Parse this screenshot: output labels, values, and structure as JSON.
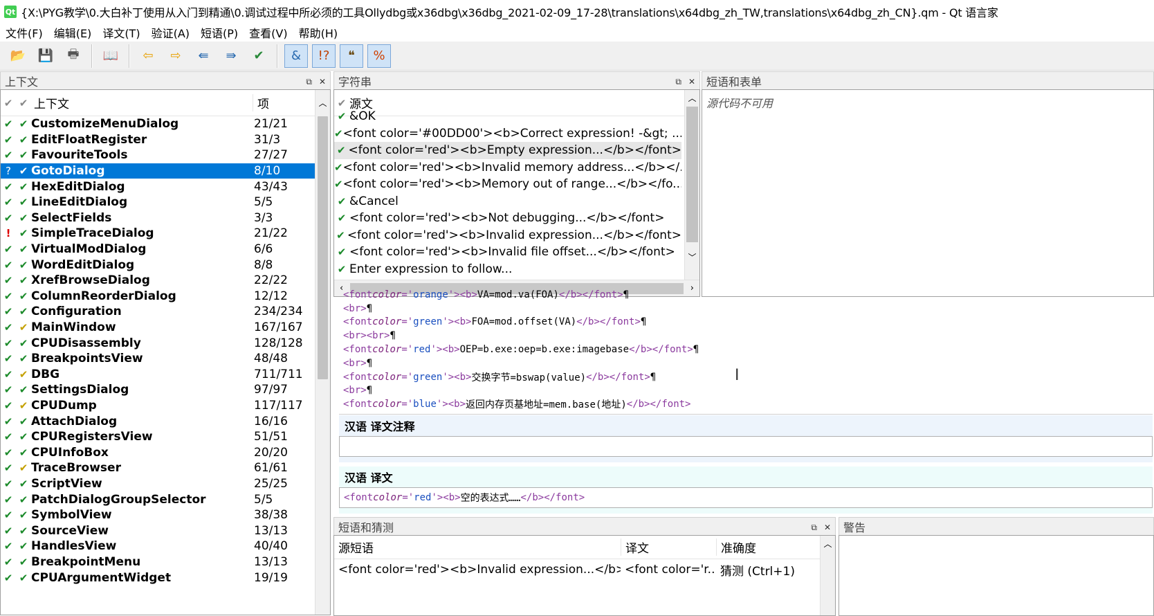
{
  "window": {
    "title": "{X:\\PYG教学\\0.大白补丁使用从入门到精通\\0.调试过程中所必须的工具Ollydbg或x36dbg\\x36dbg_2021-02-09_17-28\\translations\\x64dbg_zh_TW,translations\\x64dbg_zh_CN}.qm - Qt 语言家",
    "icon_label": "Qt"
  },
  "menu": [
    "文件(F)",
    "编辑(E)",
    "译文(T)",
    "验证(A)",
    "短语(P)",
    "查看(V)",
    "帮助(H)"
  ],
  "toolbar": {
    "buttons": [
      {
        "icon": "open-folder-icon",
        "glyph": "📂",
        "active": false
      },
      {
        "icon": "save-icon",
        "glyph": "💾",
        "active": false
      },
      {
        "icon": "print-icon",
        "glyph": "🖶",
        "active": false
      },
      {
        "icon": "phrasebook-icon",
        "glyph": "📖",
        "active": false
      },
      {
        "icon": "prev-arrow-icon",
        "glyph": "⇦",
        "active": false
      },
      {
        "icon": "next-arrow-icon",
        "glyph": "⇨",
        "active": false
      },
      {
        "icon": "prev-unfinished-icon",
        "glyph": "⇚",
        "active": false
      },
      {
        "icon": "next-unfinished-icon",
        "glyph": "⇛",
        "active": false
      },
      {
        "icon": "done-next-icon",
        "glyph": "✔",
        "active": false
      },
      {
        "icon": "accelerator-check-icon",
        "glyph": "&",
        "active": true
      },
      {
        "icon": "punctuation-check-icon",
        "glyph": "!?",
        "active": true
      },
      {
        "icon": "phrase-match-icon",
        "glyph": "❝",
        "active": true
      },
      {
        "icon": "placeholder-check-icon",
        "glyph": "%",
        "active": true
      }
    ]
  },
  "context_panel": {
    "title": "上下文",
    "col_context": "上下文",
    "col_items": "项",
    "rows": [
      {
        "status": "ok",
        "name": "CustomizeMenuDialog",
        "count": "21/21"
      },
      {
        "status": "ok",
        "name": "EditFloatRegister",
        "count": "31/3"
      },
      {
        "status": "ok",
        "name": "FavouriteTools",
        "count": "27/27"
      },
      {
        "status": "q",
        "name": "GotoDialog",
        "count": "8/10",
        "selected": true
      },
      {
        "status": "ok",
        "name": "HexEditDialog",
        "count": "43/43"
      },
      {
        "status": "ok",
        "name": "LineEditDialog",
        "count": "5/5"
      },
      {
        "status": "ok",
        "name": "SelectFields",
        "count": "3/3"
      },
      {
        "status": "err",
        "name": "SimpleTraceDialog",
        "count": "21/22"
      },
      {
        "status": "ok",
        "name": "VirtualModDialog",
        "count": "6/6"
      },
      {
        "status": "ok",
        "name": "WordEditDialog",
        "count": "8/8"
      },
      {
        "status": "ok",
        "name": "XrefBrowseDialog",
        "count": "22/22"
      },
      {
        "status": "ok",
        "name": "ColumnReorderDialog",
        "count": "12/12"
      },
      {
        "status": "ok",
        "name": "Configuration",
        "count": "234/234"
      },
      {
        "status": "gold",
        "name": "MainWindow",
        "count": "167/167"
      },
      {
        "status": "ok",
        "name": "CPUDisassembly",
        "count": "128/128"
      },
      {
        "status": "ok",
        "name": "BreakpointsView",
        "count": "48/48"
      },
      {
        "status": "gold",
        "name": "DBG",
        "count": "711/711"
      },
      {
        "status": "ok",
        "name": "SettingsDialog",
        "count": "97/97"
      },
      {
        "status": "gold",
        "name": "CPUDump",
        "count": "117/117"
      },
      {
        "status": "ok",
        "name": "AttachDialog",
        "count": "16/16"
      },
      {
        "status": "ok",
        "name": "CPURegistersView",
        "count": "51/51"
      },
      {
        "status": "ok",
        "name": "CPUInfoBox",
        "count": "20/20"
      },
      {
        "status": "gold",
        "name": "TraceBrowser",
        "count": "61/61"
      },
      {
        "status": "ok",
        "name": "ScriptView",
        "count": "25/25"
      },
      {
        "status": "ok",
        "name": "PatchDialogGroupSelector",
        "count": "5/5"
      },
      {
        "status": "ok",
        "name": "SymbolView",
        "count": "38/38"
      },
      {
        "status": "ok",
        "name": "SourceView",
        "count": "13/13"
      },
      {
        "status": "ok",
        "name": "HandlesView",
        "count": "40/40"
      },
      {
        "status": "ok",
        "name": "BreakpointMenu",
        "count": "13/13"
      },
      {
        "status": "ok",
        "name": "CPUArgumentWidget",
        "count": "19/19"
      }
    ]
  },
  "strings_panel": {
    "title": "字符串",
    "col_source": "源文",
    "rows": [
      {
        "text": "&OK",
        "selected": false
      },
      {
        "text": "<font color='#00DD00'><b>Correct expression! -&gt; ...",
        "selected": false
      },
      {
        "text": "<font color='red'><b>Empty expression...</b></font>",
        "selected": true
      },
      {
        "text": "<font color='red'><b>Invalid memory address...</b></...",
        "selected": false
      },
      {
        "text": "<font color='red'><b>Memory out of range...</b></fo...",
        "selected": false
      },
      {
        "text": "&Cancel",
        "selected": false
      },
      {
        "text": "<font color='red'><b>Not debugging...</b></font>",
        "selected": false
      },
      {
        "text": "<font color='red'><b>Invalid expression...</b></font>",
        "selected": false
      },
      {
        "text": "<font color='red'><b>Invalid file offset...</b></font>",
        "selected": false
      },
      {
        "text": "Enter expression to follow...",
        "selected": false
      }
    ]
  },
  "phrases_panel": {
    "title": "短语和表单",
    "message": "源代码不可用"
  },
  "editor": {
    "source_lines": [
      [
        {
          "c": "tag",
          "t": "<font "
        },
        {
          "c": "attr",
          "t": "color"
        },
        {
          "c": "tag",
          "t": "='"
        },
        {
          "c": "val",
          "t": "orange"
        },
        {
          "c": "tag",
          "t": "'><b>"
        },
        {
          "c": "plain",
          "t": "VA=mod.va(FOA)"
        },
        {
          "c": "tag",
          "t": "</b></font>"
        },
        {
          "c": "plain",
          "t": "¶"
        }
      ],
      [
        {
          "c": "tag",
          "t": "<br>"
        },
        {
          "c": "plain",
          "t": "¶"
        }
      ],
      [
        {
          "c": "tag",
          "t": "<font "
        },
        {
          "c": "attr",
          "t": "color"
        },
        {
          "c": "tag",
          "t": "='"
        },
        {
          "c": "val",
          "t": "green"
        },
        {
          "c": "tag",
          "t": "'><b>"
        },
        {
          "c": "plain",
          "t": "FOA=mod.offset(VA)"
        },
        {
          "c": "tag",
          "t": "</b></font>"
        },
        {
          "c": "plain",
          "t": "¶"
        }
      ],
      [
        {
          "c": "tag",
          "t": "<br><br>"
        },
        {
          "c": "plain",
          "t": "¶"
        }
      ],
      [
        {
          "c": "tag",
          "t": "<font "
        },
        {
          "c": "attr",
          "t": "color"
        },
        {
          "c": "tag",
          "t": "='"
        },
        {
          "c": "val",
          "t": "red"
        },
        {
          "c": "tag",
          "t": "'><b>"
        },
        {
          "c": "plain",
          "t": "OEP=b.exe:oep=b.exe:imagebase"
        },
        {
          "c": "tag",
          "t": "</b></font>"
        },
        {
          "c": "plain",
          "t": "¶"
        }
      ],
      [
        {
          "c": "tag",
          "t": "<br>"
        },
        {
          "c": "plain",
          "t": "¶"
        }
      ],
      [
        {
          "c": "tag",
          "t": "<font "
        },
        {
          "c": "attr",
          "t": "color"
        },
        {
          "c": "tag",
          "t": "='"
        },
        {
          "c": "val",
          "t": "green"
        },
        {
          "c": "tag",
          "t": "'><b>"
        },
        {
          "c": "plain",
          "t": "交换字节=bswap(value)"
        },
        {
          "c": "tag",
          "t": "</b></font>"
        },
        {
          "c": "plain",
          "t": "¶"
        }
      ],
      [
        {
          "c": "tag",
          "t": "<br>"
        },
        {
          "c": "plain",
          "t": "¶"
        }
      ],
      [
        {
          "c": "tag",
          "t": "<font "
        },
        {
          "c": "attr",
          "t": "color"
        },
        {
          "c": "tag",
          "t": "='"
        },
        {
          "c": "val",
          "t": "blue"
        },
        {
          "c": "tag",
          "t": "'><b>"
        },
        {
          "c": "plain",
          "t": "返回内存页基地址=mem.base(地址)"
        },
        {
          "c": "tag",
          "t": "</b></font>"
        }
      ]
    ],
    "comment_label": "汉语 译文注释",
    "comment_value": "",
    "translation_label": "汉语 译文",
    "translation_line": [
      {
        "c": "tag",
        "t": "<font "
      },
      {
        "c": "attr",
        "t": "color"
      },
      {
        "c": "tag",
        "t": "='"
      },
      {
        "c": "val",
        "t": "red"
      },
      {
        "c": "tag",
        "t": "'><b>"
      },
      {
        "c": "plain",
        "t": "空的表达式……"
      },
      {
        "c": "tag",
        "t": "</b></font>"
      }
    ]
  },
  "guess_panel": {
    "title": "短语和猜测",
    "col_source": "源短语",
    "col_translation": "译文",
    "col_accuracy": "准确度",
    "rows": [
      {
        "source": "<font color='red'><b>Invalid expression...</b>...",
        "translation": "<font color='r...",
        "accuracy": "猜测 (Ctrl+1)"
      }
    ]
  },
  "warnings_panel": {
    "title": "警告"
  },
  "colors": {
    "selection": "#0078d7",
    "check_green": "#1b8a2a",
    "warning_gold": "#c4a000",
    "error_red": "#dd0000"
  }
}
